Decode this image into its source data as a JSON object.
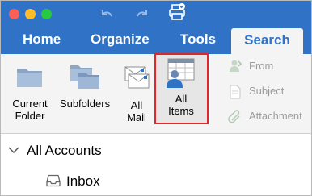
{
  "window": {
    "traffic_lights": [
      "#fc5f57",
      "#fdbc2e",
      "#28c840"
    ]
  },
  "quick_access": {
    "undo_icon": "undo-icon",
    "redo_icon": "redo-icon",
    "print_icon": "print-icon"
  },
  "tabs": [
    {
      "label": "Home",
      "active": false
    },
    {
      "label": "Organize",
      "active": false
    },
    {
      "label": "Tools",
      "active": false
    },
    {
      "label": "Search",
      "active": true
    }
  ],
  "ribbon": {
    "scope_buttons": [
      {
        "line1": "Current",
        "line2": "Folder",
        "icon": "folder-icon"
      },
      {
        "line1": "Subfolders",
        "line2": "",
        "icon": "subfolders-icon"
      },
      {
        "line1": "All",
        "line2": "Mail",
        "icon": "all-mail-icon"
      },
      {
        "line1": "All",
        "line2": "Items",
        "icon": "all-items-icon",
        "highlighted": true
      }
    ],
    "refine": [
      {
        "label": "From",
        "icon": "from-person-icon",
        "enabled": false
      },
      {
        "label": "Subject",
        "icon": "subject-document-icon",
        "enabled": false
      },
      {
        "label": "Attachment",
        "icon": "attachment-icon",
        "enabled": false
      }
    ]
  },
  "navigation": {
    "accounts_label": "All Accounts",
    "inbox_label": "Inbox"
  },
  "colors": {
    "accent": "#2f72c6",
    "highlight_border": "#e0252b"
  }
}
